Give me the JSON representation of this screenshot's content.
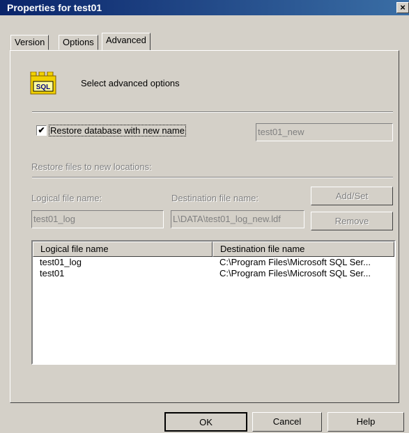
{
  "window": {
    "title": "Properties for test01",
    "close_glyph": "×"
  },
  "tabs": [
    {
      "label": "Version"
    },
    {
      "label": "Options"
    },
    {
      "label": "Advanced"
    }
  ],
  "advanced": {
    "icon_text": "SQL",
    "heading": "Select advanced options",
    "restore_checkbox": {
      "label": "Restore database with new name",
      "checked": true,
      "check_glyph": "✔"
    },
    "new_name_value": "test01_new",
    "restore_files_label": "Restore files to new locations:",
    "logical_label": "Logical file name:",
    "destination_label": "Destination file name:",
    "logical_value": "test01_log",
    "destination_value": "L\\DATA\\test01_log_new.ldf",
    "add_set_label": "Add/Set",
    "remove_label": "Remove"
  },
  "files_table": {
    "headers": [
      "Logical file name",
      "Destination file name"
    ],
    "rows": [
      [
        "test01_log",
        "C:\\Program Files\\Microsoft SQL Ser..."
      ],
      [
        "test01",
        "C:\\Program Files\\Microsoft SQL Ser..."
      ]
    ]
  },
  "buttons": {
    "ok": "OK",
    "cancel": "Cancel",
    "help": "Help"
  },
  "colors": {
    "title_start": "#0a246a",
    "title_end": "#3a6ea5",
    "face": "#d4d0c8",
    "disabled_text": "#808080"
  }
}
